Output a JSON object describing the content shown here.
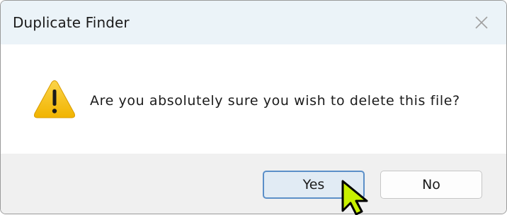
{
  "window": {
    "title": "Duplicate Finder",
    "close_icon": "close-icon"
  },
  "message": {
    "icon": "warning-icon",
    "text": "Are you absolutely sure you wish to delete this file?"
  },
  "buttons": {
    "yes_label": "Yes",
    "no_label": "No"
  },
  "colors": {
    "titlebar_bg": "#ebf3f8",
    "footer_bg": "#f0f0f0",
    "warning_yellow": "#f7c31a",
    "default_button_border": "#5b8fc8",
    "cursor_fill": "#c8f000"
  }
}
